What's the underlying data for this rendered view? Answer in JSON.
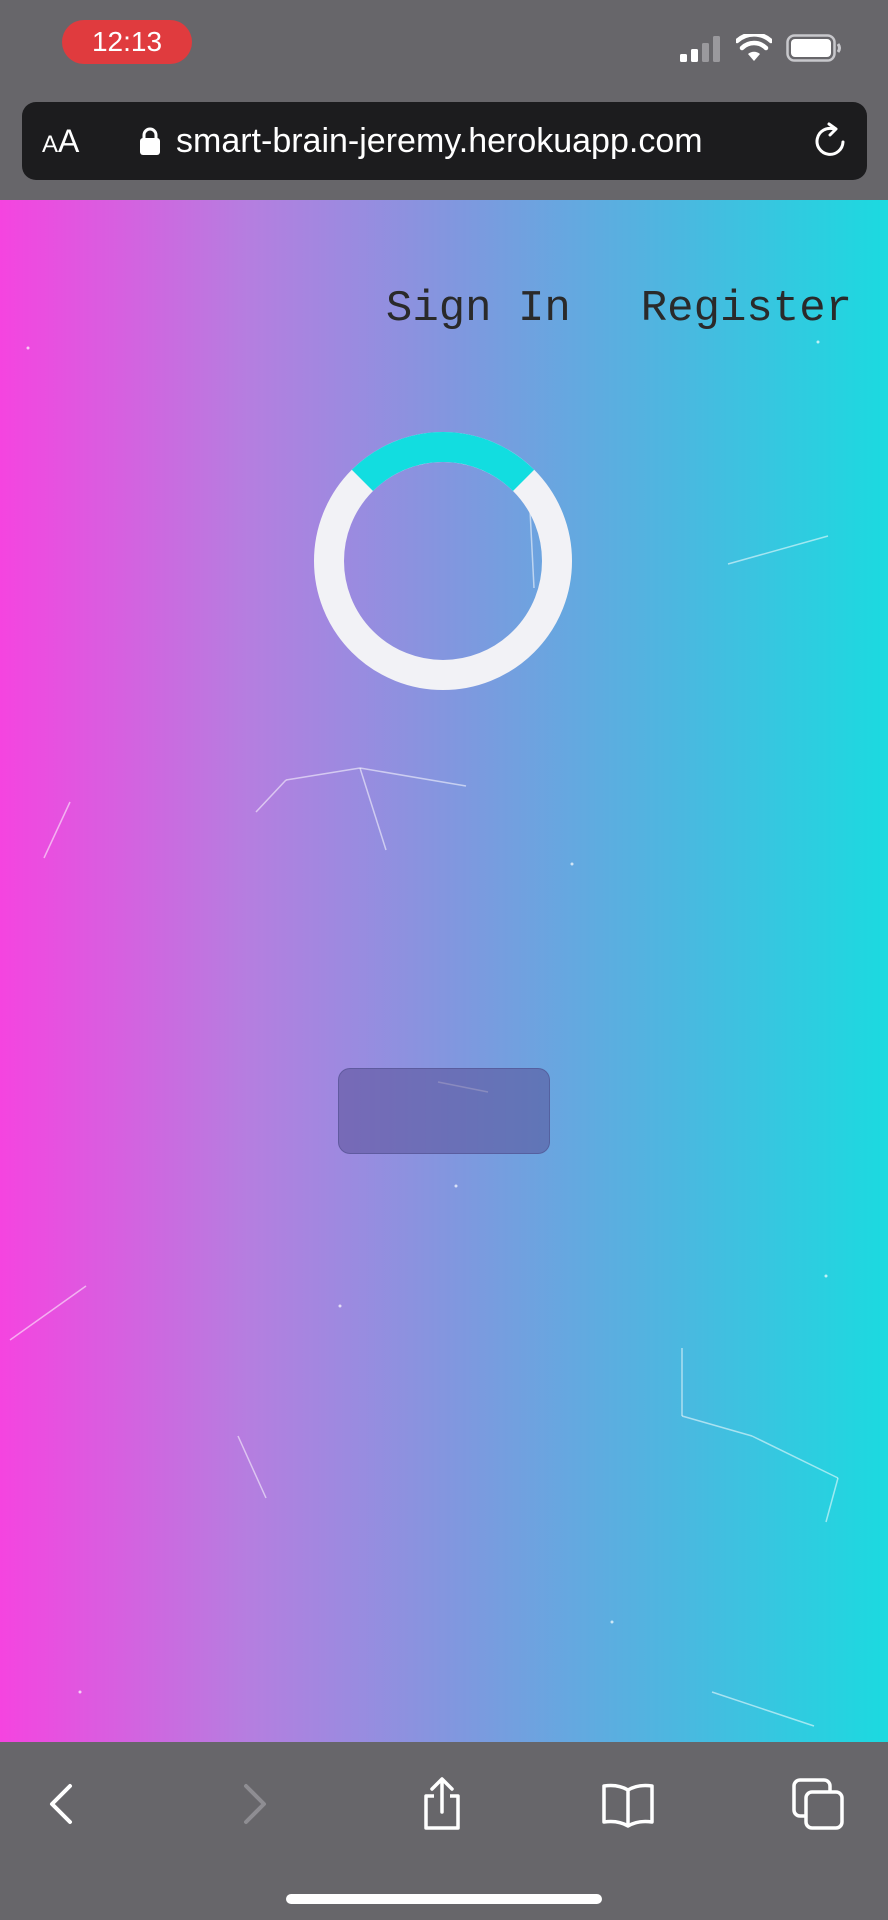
{
  "status_bar": {
    "time": "12:13",
    "icons": [
      "signal-icon",
      "wifi-icon",
      "battery-icon"
    ]
  },
  "browser": {
    "text_size_label_small": "A",
    "text_size_label_large": "A",
    "url": "smart-brain-jeremy.herokuapp.com",
    "icons": [
      "lock-icon",
      "reload-icon"
    ]
  },
  "nav": {
    "sign_in": "Sign In",
    "register": "Register"
  },
  "loader": {
    "state": "loading",
    "track_color": "#f2f2f6",
    "arc_color": "#12dde0"
  },
  "toolbar": {
    "icons": [
      "back-icon",
      "forward-icon",
      "share-icon",
      "bookmarks-icon",
      "tabs-icon"
    ]
  },
  "colors": {
    "gradient_left": "#f544e0",
    "gradient_right": "#1bdae0",
    "chrome": "#67666a",
    "time_pill": "#e03b3e"
  }
}
